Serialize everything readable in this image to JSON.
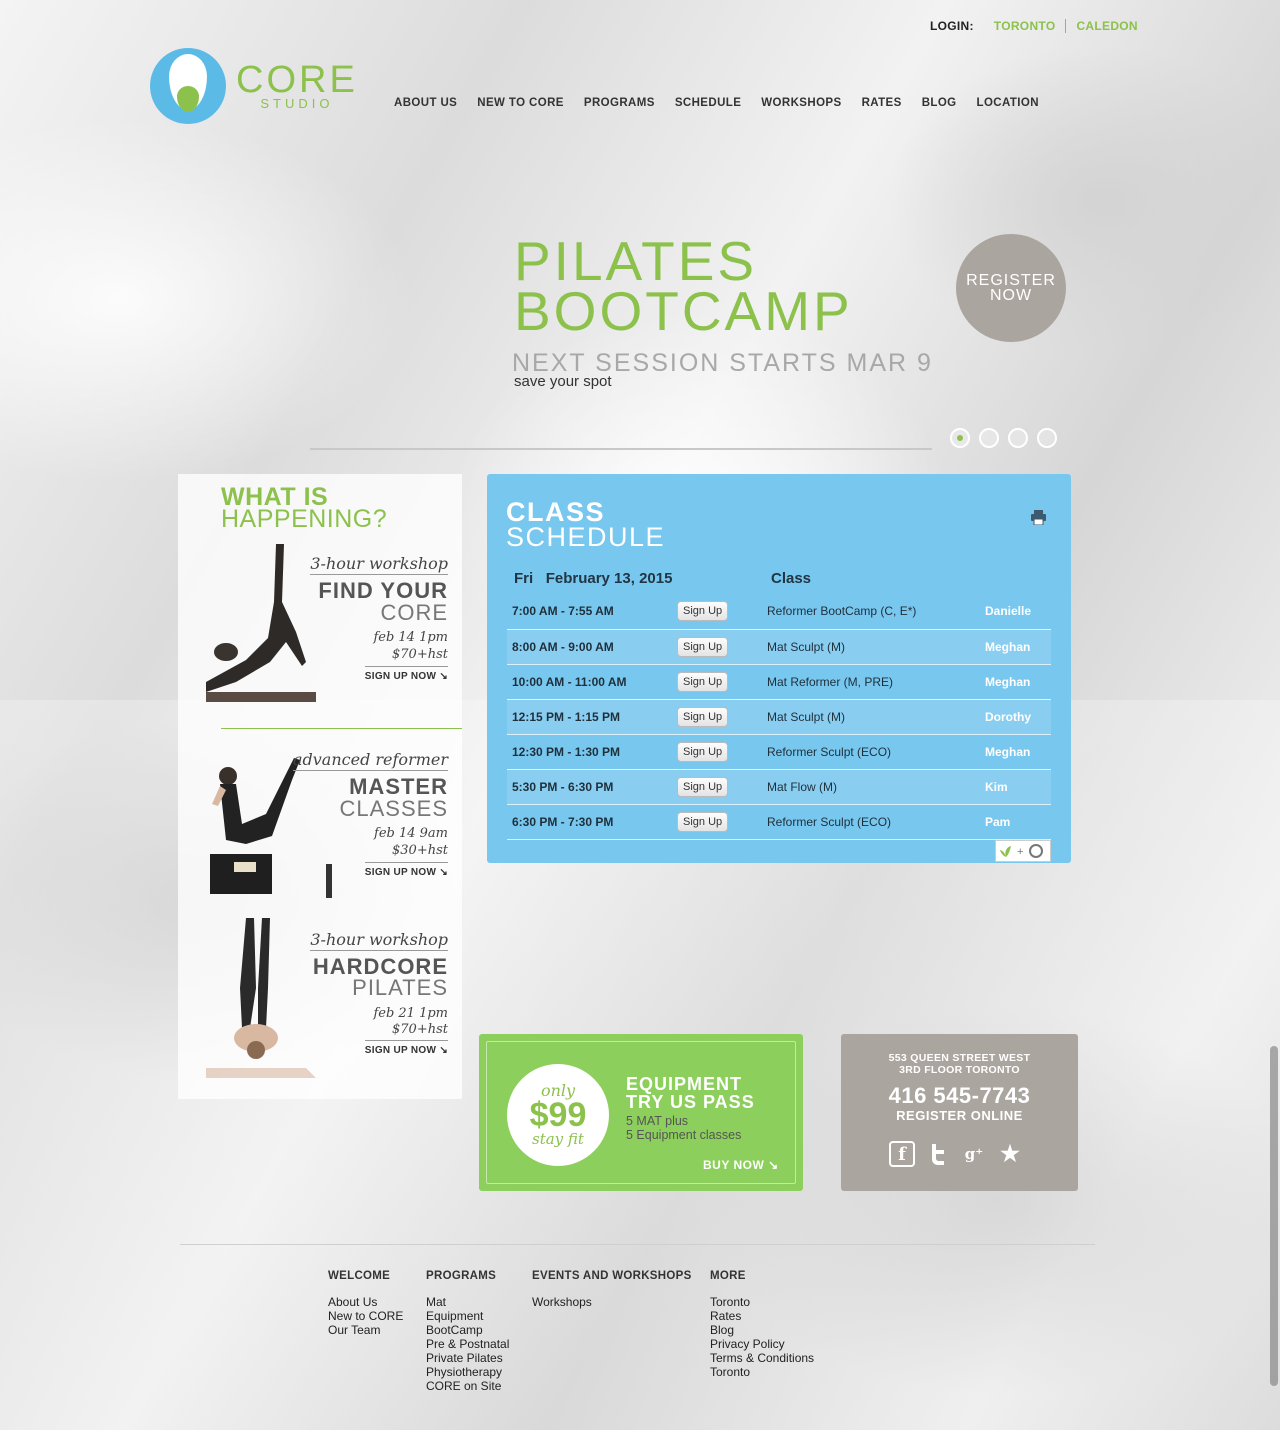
{
  "login": {
    "label": "LOGIN:",
    "links": [
      "TORONTO",
      "CALEDON"
    ]
  },
  "logo": {
    "name": "CORE",
    "sub": "STUDIO"
  },
  "nav": [
    "ABOUT US",
    "NEW TO CORE",
    "PROGRAMS",
    "SCHEDULE",
    "WORKSHOPS",
    "RATES",
    "BLOG",
    "LOCATION"
  ],
  "hero": {
    "title1": "PILATES",
    "title2": "BOOTCAMP",
    "subtitle": "NEXT SESSION STARTS MAR 9",
    "note": "save your spot",
    "register1": "REGISTER",
    "register2": "NOW",
    "active_slide": 1,
    "slide_count": 4
  },
  "happening": {
    "title1": "WHAT IS",
    "title2": "HAPPENING?",
    "events": [
      {
        "kicker": "3-hour workshop",
        "name1": "FIND YOUR",
        "name2": "CORE",
        "date": "feb 14 1pm",
        "price": "$70+hst",
        "cta": "SIGN UP NOW ↘"
      },
      {
        "kicker": "advanced reformer",
        "name1": "MASTER",
        "name2": "CLASSES",
        "date": "feb 14 9am",
        "price": "$30+hst",
        "cta": "SIGN UP NOW ↘"
      },
      {
        "kicker": "3-hour workshop",
        "name1": "HARDCORE",
        "name2": "PILATES",
        "date": "feb 21 1pm",
        "price": "$70+hst",
        "cta": "SIGN UP NOW ↘"
      }
    ]
  },
  "schedule": {
    "title1": "CLASS",
    "title2": "SCHEDULE",
    "day": "Fri",
    "date": "February 13, 2015",
    "class_header": "Class",
    "signup_label": "Sign Up",
    "rows": [
      {
        "time": "7:00 AM - 7:55 AM",
        "class": "Reformer BootCamp (C, E*)",
        "instructor": "Danielle"
      },
      {
        "time": "8:00 AM - 9:00 AM",
        "class": "Mat Sculpt (M)",
        "instructor": "Meghan"
      },
      {
        "time": "10:00 AM - 11:00 AM",
        "class": "Mat Reformer (M, PRE)",
        "instructor": "Meghan"
      },
      {
        "time": "12:15 PM - 1:15 PM",
        "class": "Mat Sculpt (M)",
        "instructor": "Dorothy"
      },
      {
        "time": "12:30 PM - 1:30 PM",
        "class": "Reformer Sculpt (ECO)",
        "instructor": "Meghan"
      },
      {
        "time": "5:30 PM - 6:30 PM",
        "class": "Mat Flow (M)",
        "instructor": "Kim"
      },
      {
        "time": "6:30 PM - 7:30 PM",
        "class": "Reformer Sculpt (ECO)",
        "instructor": "Pam"
      }
    ]
  },
  "equipment": {
    "only": "only",
    "price": "$99",
    "stay": "stay fit",
    "title1": "EQUIPMENT",
    "title2": "TRY US PASS",
    "line1": "5 MAT plus",
    "line2": "5 Equipment classes",
    "cta": "BUY NOW ↘"
  },
  "contact": {
    "addr1": "553 QUEEN STREET WEST",
    "addr2": "3RD FLOOR TORONTO",
    "phone": "416 545-7743",
    "register": "REGISTER ONLINE",
    "social_icons": [
      "facebook-icon",
      "twitter-icon",
      "google-plus-icon",
      "star-icon"
    ]
  },
  "footer": {
    "cols": [
      {
        "head": "WELCOME",
        "links": [
          "About Us",
          "New to CORE",
          "Our Team"
        ]
      },
      {
        "head": "PROGRAMS",
        "links": [
          "Mat",
          "Equipment",
          "BootCamp",
          "Pre & Postnatal",
          "Private Pilates",
          "Physiotherapy",
          "CORE on Site"
        ]
      },
      {
        "head": "EVENTS AND WORKSHOPS",
        "links": [
          "Workshops"
        ]
      },
      {
        "head": "MORE",
        "links": [
          "Toronto",
          "Rates",
          "Blog",
          "Privacy Policy",
          "Terms & Conditions",
          "Toronto"
        ]
      }
    ]
  },
  "colors": {
    "green": "#8cc14c",
    "blue": "#78c7ef",
    "taupe": "#aba59f",
    "logo_blue": "#5cbbe6"
  }
}
